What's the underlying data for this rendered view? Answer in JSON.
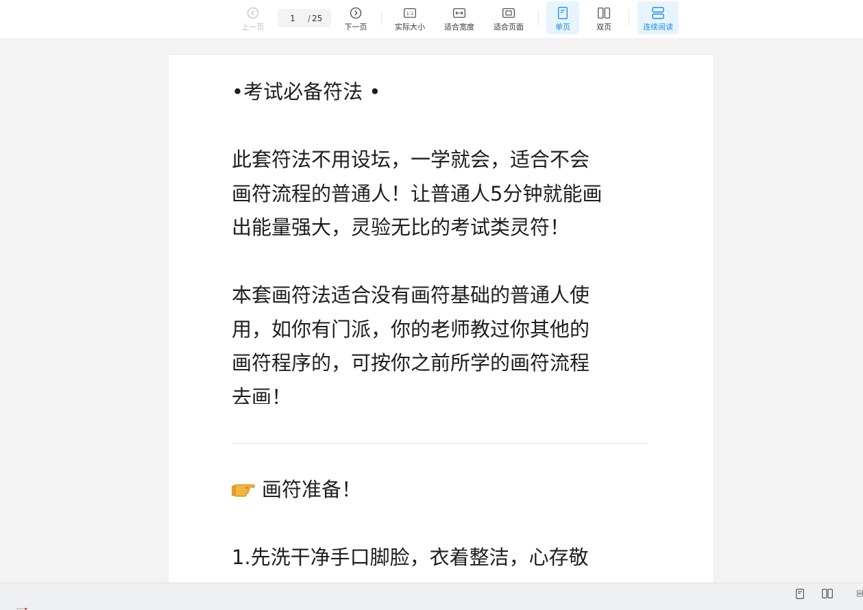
{
  "toolbar": {
    "prev_label": "上一页",
    "current_page": "1",
    "page_total": "25",
    "page_separator": "/",
    "next_label": "下一页",
    "actual_size_label": "实际大小",
    "fit_width_label": "适合宽度",
    "fit_page_label": "适合页面",
    "single_page_label": "单页",
    "double_page_label": "双页",
    "continuous_label": "连续阅读",
    "accent_color": "#1a8ee6",
    "actual_size_icon_text": "1:1"
  },
  "document": {
    "title_line": "•考试必备符法 •",
    "para1": [
      "此套符法不用设坛，一学就会，适合不会",
      "画符流程的普通人！让普通人5分钟就能画",
      "出能量强大，灵验无比的考试类灵符！"
    ],
    "para2": [
      "本套画符法适合没有画符基础的普通人使",
      "用，如你有门派，你的老师教过你其他的",
      "画符程序的，可按你之前所学的画符流程",
      "去画！"
    ],
    "section_heading": "画符准备！",
    "step1": [
      "1.先洗干净手口脚脸，衣着整洁，心存敬"
    ]
  },
  "status_bar": {
    "icons": [
      "single-page-icon",
      "double-page-icon",
      "continuous-icon"
    ]
  }
}
